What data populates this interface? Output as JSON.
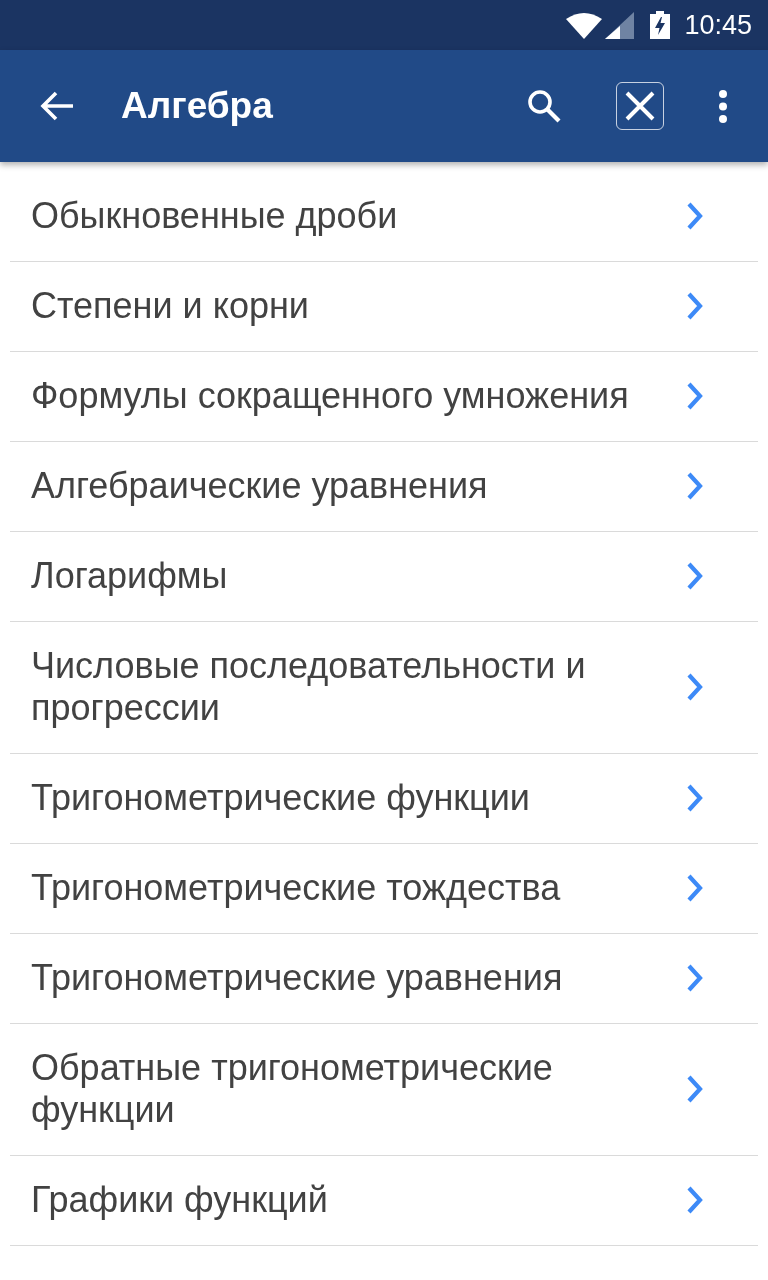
{
  "status_bar": {
    "time": "10:45"
  },
  "app_bar": {
    "title": "Алгебра"
  },
  "items": [
    {
      "label": "Обыкновенные дроби"
    },
    {
      "label": "Степени и корни"
    },
    {
      "label": "Формулы сокращенного умножения"
    },
    {
      "label": "Алгебраические уравнения"
    },
    {
      "label": "Логарифмы"
    },
    {
      "label": "Числовые последовательности и прогрессии"
    },
    {
      "label": "Тригонометрические функции"
    },
    {
      "label": "Тригонометрические тождества"
    },
    {
      "label": "Тригонометрические уравнения"
    },
    {
      "label": "Обратные тригонометрические функции"
    },
    {
      "label": "Графики функций"
    }
  ]
}
